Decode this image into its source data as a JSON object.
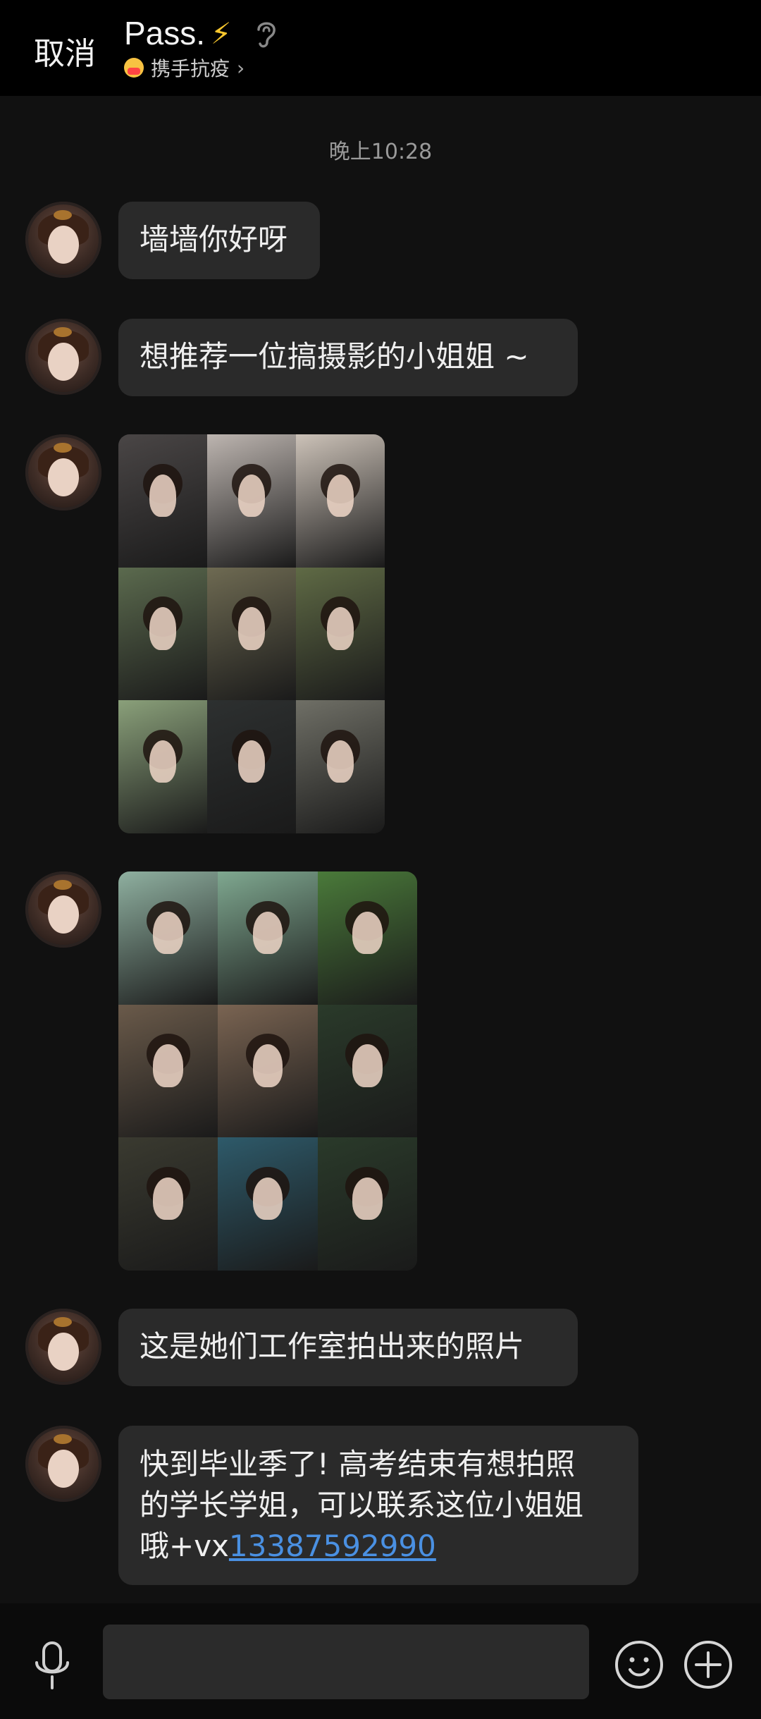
{
  "header": {
    "cancel_label": "取消",
    "title": "Pass.",
    "title_emoji": "⚡",
    "subtitle": "携手抗疫",
    "subtitle_chevron": "›"
  },
  "timestamp": "晚上10:28",
  "messages": [
    {
      "type": "text",
      "text": "墙墙你好呀"
    },
    {
      "type": "text",
      "text": "想推荐一位搞摄影的小姐姐 ~"
    },
    {
      "type": "image_grid",
      "rows": 3,
      "cols": 3
    },
    {
      "type": "image_grid",
      "rows": 3,
      "cols": 3
    },
    {
      "type": "text",
      "text": "这是她们工作室拍出来的照片"
    },
    {
      "type": "text",
      "line1": "快到毕业季了! 高考结束有想拍照",
      "line2": "的学长学姐，可以联系这位小姐姐",
      "line3_prefix": "哦+vx",
      "phone": "13387592990"
    }
  ],
  "ghost_text": "的学长学姐，可以联系这位小姐姐",
  "input": {
    "value": "",
    "placeholder": ""
  },
  "colors": {
    "bubble": "#2a2a2a",
    "link": "#4a90e2",
    "background": "#111111",
    "accent_bolt": "#f8c72e"
  },
  "icons": {
    "mic": "microphone-icon",
    "emoji": "smiley-icon",
    "plus": "plus-circle-icon",
    "ear": "ear-icon"
  },
  "grid1_colors": [
    "#4a4646",
    "#bdb5b0",
    "#ccc2b8",
    "#5b6a4e",
    "#6e6a52",
    "#5f6a45",
    "#8aa07a",
    "#2d3030",
    "#6f6f66"
  ],
  "grid2_colors": [
    "#8fb0a0",
    "#7fa890",
    "#4a7a3a",
    "#6a5a4a",
    "#7a6452",
    "#2a3a2a",
    "#3a3a30",
    "#2e5a6a",
    "#2a3a2a"
  ]
}
